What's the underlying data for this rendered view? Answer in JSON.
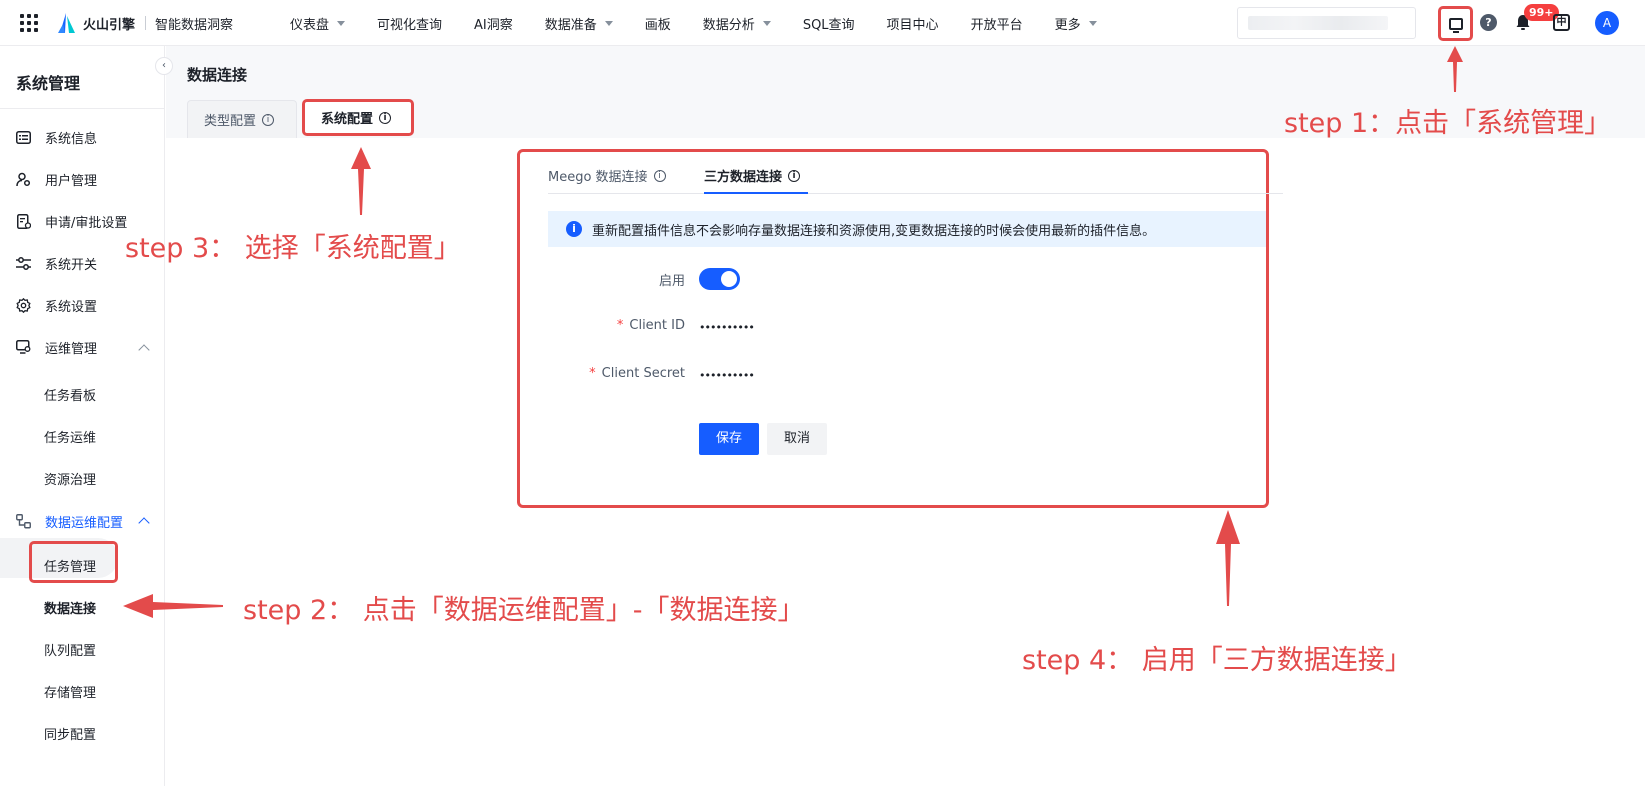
{
  "topbar": {
    "brand_name": "火山引擎",
    "product_name": "智能数据洞察",
    "nav": [
      {
        "label": "仪表盘",
        "dropdown": true
      },
      {
        "label": "可视化查询",
        "dropdown": false
      },
      {
        "label": "AI洞察",
        "dropdown": false
      },
      {
        "label": "数据准备",
        "dropdown": true
      },
      {
        "label": "画板",
        "dropdown": false
      },
      {
        "label": "数据分析",
        "dropdown": true
      },
      {
        "label": "SQL查询",
        "dropdown": false
      },
      {
        "label": "项目中心",
        "dropdown": false
      },
      {
        "label": "开放平台",
        "dropdown": false
      },
      {
        "label": "更多",
        "dropdown": true
      }
    ],
    "notification_badge": "99+",
    "help_glyph": "?",
    "lang_glyph": "中",
    "avatar_initial": "A"
  },
  "sidebar": {
    "title": "系统管理",
    "items": [
      {
        "label": "系统信息",
        "icon": "info-list-icon"
      },
      {
        "label": "用户管理",
        "icon": "user-gear-icon"
      },
      {
        "label": "申请/审批设置",
        "icon": "approval-doc-icon"
      },
      {
        "label": "系统开关",
        "icon": "sliders-icon"
      },
      {
        "label": "系统设置",
        "icon": "gear-icon"
      },
      {
        "label": "运维管理",
        "icon": "monitor-gear-icon"
      }
    ],
    "ops_subitems": [
      "任务看板",
      "任务运维",
      "资源治理"
    ],
    "data_ops": {
      "label": "数据运维配置",
      "icon": "data-flow-icon"
    },
    "data_ops_subitems": [
      "任务管理",
      "数据连接",
      "队列配置",
      "存储管理",
      "同步配置"
    ]
  },
  "page": {
    "title": "数据连接",
    "tabs": [
      "类型配置",
      "系统配置"
    ],
    "inner_tabs": [
      "Meego 数据连接",
      "三方数据连接"
    ],
    "alert_text": "重新配置插件信息不会影响存量数据连接和资源使用,变更数据连接的时候会使用最新的插件信息。",
    "form": {
      "enable_label": "启用",
      "enabled": true,
      "client_id_label": "Client ID",
      "client_id_value": "••••••••••",
      "client_secret_label": "Client Secret",
      "client_secret_value": "••••••••••",
      "save_label": "保存",
      "cancel_label": "取消"
    }
  },
  "annotations": {
    "step1": "step 1：点击「系统管理」",
    "step2": "step 2： 点击「数据运维配置」-「数据连接」",
    "step3": "step 3： 选择「系统配置」",
    "step4": "step 4： 启用「三方数据连接」"
  },
  "colors": {
    "primary": "#165dff",
    "annotation": "#e34b4b",
    "alert_bg": "#e8f3ff",
    "badge": "#f53f3f"
  }
}
